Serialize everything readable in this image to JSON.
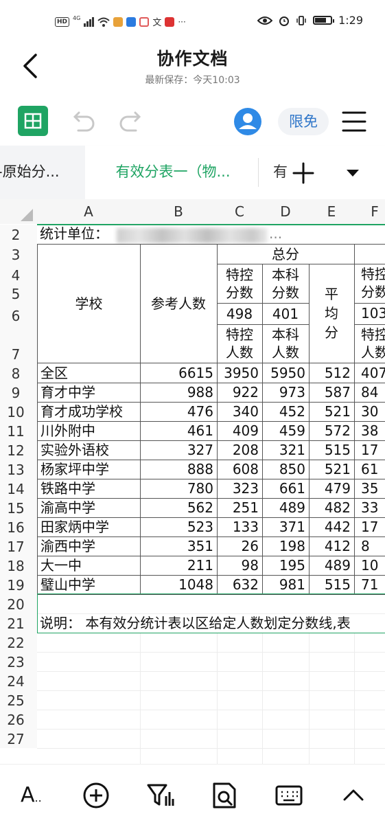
{
  "status_bar": {
    "left_badges": [
      "HD",
      "4G"
    ],
    "time": "1:29"
  },
  "header": {
    "title": "协作文档",
    "save_status": "最新保存：今天10:03"
  },
  "toolbar": {
    "sheet_icon": "spreadsheet-icon",
    "undo_icon": "undo-icon",
    "redo_icon": "redo-icon",
    "avatar_icon": "user-avatar-icon",
    "badge_label": "限免",
    "menu_icon": "hamburger-menu-icon"
  },
  "tabs": {
    "items": [
      {
        "label": "-原始分..."
      },
      {
        "label": "有效分表一（物..."
      },
      {
        "label": "有"
      }
    ],
    "active_index": 1,
    "add_icon": "plus-icon",
    "more_icon": "dropdown-triangle-icon"
  },
  "sheet": {
    "columns": [
      "A",
      "B",
      "C",
      "D",
      "E",
      "F"
    ],
    "row_numbers": [
      "2",
      "3",
      "4",
      "5",
      "6",
      "7",
      "8",
      "9",
      "10",
      "11",
      "12",
      "13",
      "14",
      "15",
      "16",
      "17",
      "18",
      "19",
      "20",
      "21",
      "22",
      "23",
      "24",
      "25",
      "26",
      "27"
    ],
    "unit_label": "统计单位：",
    "unit_fragment": "...",
    "header": {
      "school": "学校",
      "examinees": "参考人数",
      "total": "总分",
      "special_score": "特控分数",
      "undergrad_score": "本科分数",
      "special_line": "498",
      "undergrad_line": "401",
      "special_count": "特控人数",
      "undergrad_count": "本科人数",
      "average": "平均分",
      "f_top": "特控分数",
      "f_line": "103",
      "f_count": "特控人数"
    },
    "rows": [
      {
        "school": "全区",
        "examinees": "6615",
        "special": "3950",
        "undergrad": "5950",
        "average": "512",
        "f": "407"
      },
      {
        "school": "育才中学",
        "examinees": "988",
        "special": "922",
        "undergrad": "973",
        "average": "587",
        "f": "84"
      },
      {
        "school": "育才成功学校",
        "examinees": "476",
        "special": "340",
        "undergrad": "452",
        "average": "521",
        "f": "30"
      },
      {
        "school": "川外附中",
        "examinees": "461",
        "special": "409",
        "undergrad": "459",
        "average": "572",
        "f": "38"
      },
      {
        "school": "实验外语校",
        "examinees": "327",
        "special": "208",
        "undergrad": "321",
        "average": "515",
        "f": "17"
      },
      {
        "school": "杨家坪中学",
        "examinees": "888",
        "special": "608",
        "undergrad": "850",
        "average": "521",
        "f": "61"
      },
      {
        "school": "铁路中学",
        "examinees": "780",
        "special": "323",
        "undergrad": "661",
        "average": "479",
        "f": "35"
      },
      {
        "school": "渝高中学",
        "examinees": "562",
        "special": "251",
        "undergrad": "489",
        "average": "482",
        "f": "33"
      },
      {
        "school": "田家炳中学",
        "examinees": "523",
        "special": "133",
        "undergrad": "371",
        "average": "442",
        "f": "17"
      },
      {
        "school": "渝西中学",
        "examinees": "351",
        "special": "26",
        "undergrad": "198",
        "average": "412",
        "f": "8"
      },
      {
        "school": "大一中",
        "examinees": "211",
        "special": "98",
        "undergrad": "195",
        "average": "489",
        "f": "10"
      },
      {
        "school": "璧山中学",
        "examinees": "1048",
        "special": "632",
        "undergrad": "981",
        "average": "515",
        "f": "71"
      }
    ],
    "note": "说明：  本有效分统计表以区给定人数划定分数线,表"
  },
  "bottom_bar": {
    "font_label": "A",
    "font_ellipsis": "..",
    "icons": [
      "text-format-icon",
      "insert-plus-icon",
      "filter-icon",
      "find-icon",
      "keyboard-icon",
      "collapse-chevron-icon"
    ]
  },
  "colors": {
    "accent_green": "#1fa463",
    "badge_blue": "#2f76c9",
    "avatar_blue": "#2f8ae6"
  }
}
